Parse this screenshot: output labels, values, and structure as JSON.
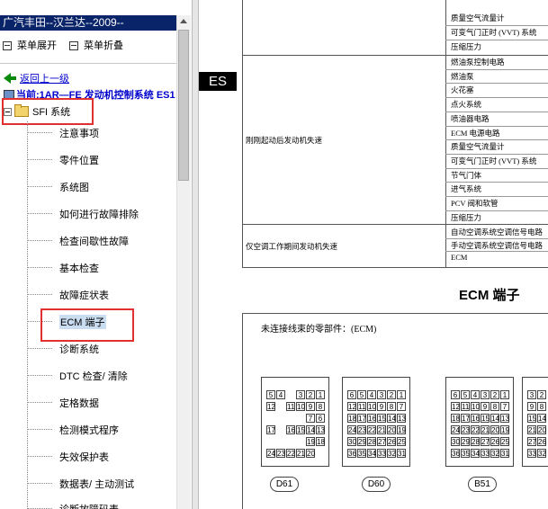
{
  "window": {
    "title": "广汽丰田--汉兰达--2009--"
  },
  "toolbar": {
    "expand_label": "菜单展开",
    "collapse_label": "菜单折叠"
  },
  "nav": {
    "back_label": "返回上一级",
    "current_label": "当前:1AR—FE 发动机控制系统 ES1"
  },
  "tree": {
    "root_label": "SFI 系统",
    "items": [
      {
        "label": "注意事项"
      },
      {
        "label": "零件位置"
      },
      {
        "label": "系统图"
      },
      {
        "label": "如何进行故障排除"
      },
      {
        "label": "检查间歇性故障"
      },
      {
        "label": "基本检查"
      },
      {
        "label": "故障症状表"
      },
      {
        "label": "ECM 端子"
      },
      {
        "label": "诊断系统"
      },
      {
        "label": "DTC 检查/ 清除"
      },
      {
        "label": "定格数据"
      },
      {
        "label": "检测模式程序"
      },
      {
        "label": "失效保护表"
      },
      {
        "label": "数据表/ 主动测试"
      },
      {
        "label": "诊断故障码表"
      }
    ],
    "selected_index": 7
  },
  "doc": {
    "section_tab": "ES",
    "table_top": [
      "质量空气流量计",
      "可变气门正时 (VVT) 系统",
      "压缩压力"
    ],
    "group1_symptom": "刚刚起动后发动机失速",
    "group1_items": [
      "燃油泵控制电路",
      "燃油泵",
      "火花塞",
      "点火系统",
      "喷油器电路",
      "ECM 电源电路",
      "质量空气流量计",
      "可变气门正时 (VVT) 系统",
      "节气门体",
      "进气系统",
      "PCV 阀和软管",
      "压缩压力"
    ],
    "group2_symptom": "仅空调工作期间发动机失速",
    "group2_items": [
      "自动空调系统空调信号电路",
      "手动空调系统空调信号电路",
      "ECM"
    ],
    "heading": "ECM 端子",
    "diagram_caption": "未连接线束的零部件：(ECM)",
    "connectors": [
      {
        "label": "D61",
        "rows": [
          [
            "5",
            "4",
            "3",
            "2",
            "1"
          ],
          [
            "12",
            "11",
            "10",
            "9",
            "8"
          ],
          [
            "17",
            "16",
            "15",
            "14",
            "13"
          ],
          [
            "",
            "",
            "",
            "19",
            "18"
          ],
          [
            "24",
            "23",
            "22",
            "21",
            "20"
          ]
        ]
      },
      {
        "label": "D60",
        "rows": [
          [
            "6",
            "5",
            "4",
            "3",
            "2",
            "1"
          ],
          [
            "15",
            "14",
            "13",
            "12",
            "11",
            "10",
            "9",
            "8",
            "7"
          ],
          [
            "22",
            "21",
            "20",
            "19",
            "18",
            "17",
            "16",
            "15",
            "14"
          ],
          [
            "",
            "",
            "",
            "",
            "",
            "",
            "",
            "",
            ""
          ],
          [
            "36",
            "35",
            "34",
            "33",
            "32",
            "31"
          ]
        ]
      },
      {
        "label": "B51",
        "rows": [
          [
            "6",
            "5",
            "4",
            "3",
            "2",
            "1"
          ],
          [
            "15",
            "14",
            "13",
            "12",
            "11",
            "10",
            "9",
            "8",
            "7"
          ],
          [
            "22",
            "21",
            "20",
            "19",
            "18",
            "17",
            "16",
            "15",
            "14"
          ],
          [
            "",
            "",
            "",
            "",
            "",
            "",
            "",
            "",
            ""
          ],
          [
            "36",
            "35",
            "34",
            "33",
            "32",
            "31"
          ]
        ]
      }
    ],
    "d61_grid": [
      [
        "5",
        "4",
        "",
        "3",
        "2",
        "1"
      ],
      [
        "12",
        "",
        "11",
        "10",
        "9",
        "8"
      ],
      [
        "",
        "",
        "",
        "",
        "7",
        "6"
      ],
      [
        "17",
        "",
        "16",
        "15",
        "14",
        "13"
      ],
      [
        "",
        "",
        "",
        "",
        "19",
        "18"
      ],
      [
        "24",
        "23",
        "22",
        "21",
        "20",
        ""
      ]
    ],
    "d60_grid": [
      [
        "6",
        "5",
        "4",
        "3",
        "2",
        "1"
      ],
      [
        "12",
        "11",
        "10",
        "9",
        "8",
        "7"
      ],
      [
        "18",
        "17",
        "16",
        "15",
        "14",
        "13"
      ],
      [
        "24",
        "23",
        "22",
        "21",
        "20",
        "19"
      ],
      [
        "30",
        "29",
        "28",
        "27",
        "26",
        "25"
      ],
      [
        "36",
        "35",
        "34",
        "33",
        "32",
        "31"
      ]
    ],
    "b51_grid": [
      [
        "6",
        "5",
        "4",
        "3",
        "2",
        "1"
      ],
      [
        "12",
        "11",
        "10",
        "9",
        "8",
        "7"
      ],
      [
        "18",
        "17",
        "16",
        "15",
        "14",
        "13"
      ],
      [
        "24",
        "23",
        "22",
        "21",
        "20",
        "19"
      ],
      [
        "30",
        "29",
        "28",
        "27",
        "26",
        "25"
      ],
      [
        "36",
        "35",
        "34",
        "33",
        "32",
        "31"
      ]
    ],
    "right_partial_grid": [
      [
        "3",
        "2"
      ],
      [
        "9",
        "8"
      ],
      [
        "15",
        "14"
      ],
      [
        "21",
        "20"
      ],
      [
        "27",
        "26"
      ],
      [
        "33",
        "32"
      ]
    ]
  }
}
